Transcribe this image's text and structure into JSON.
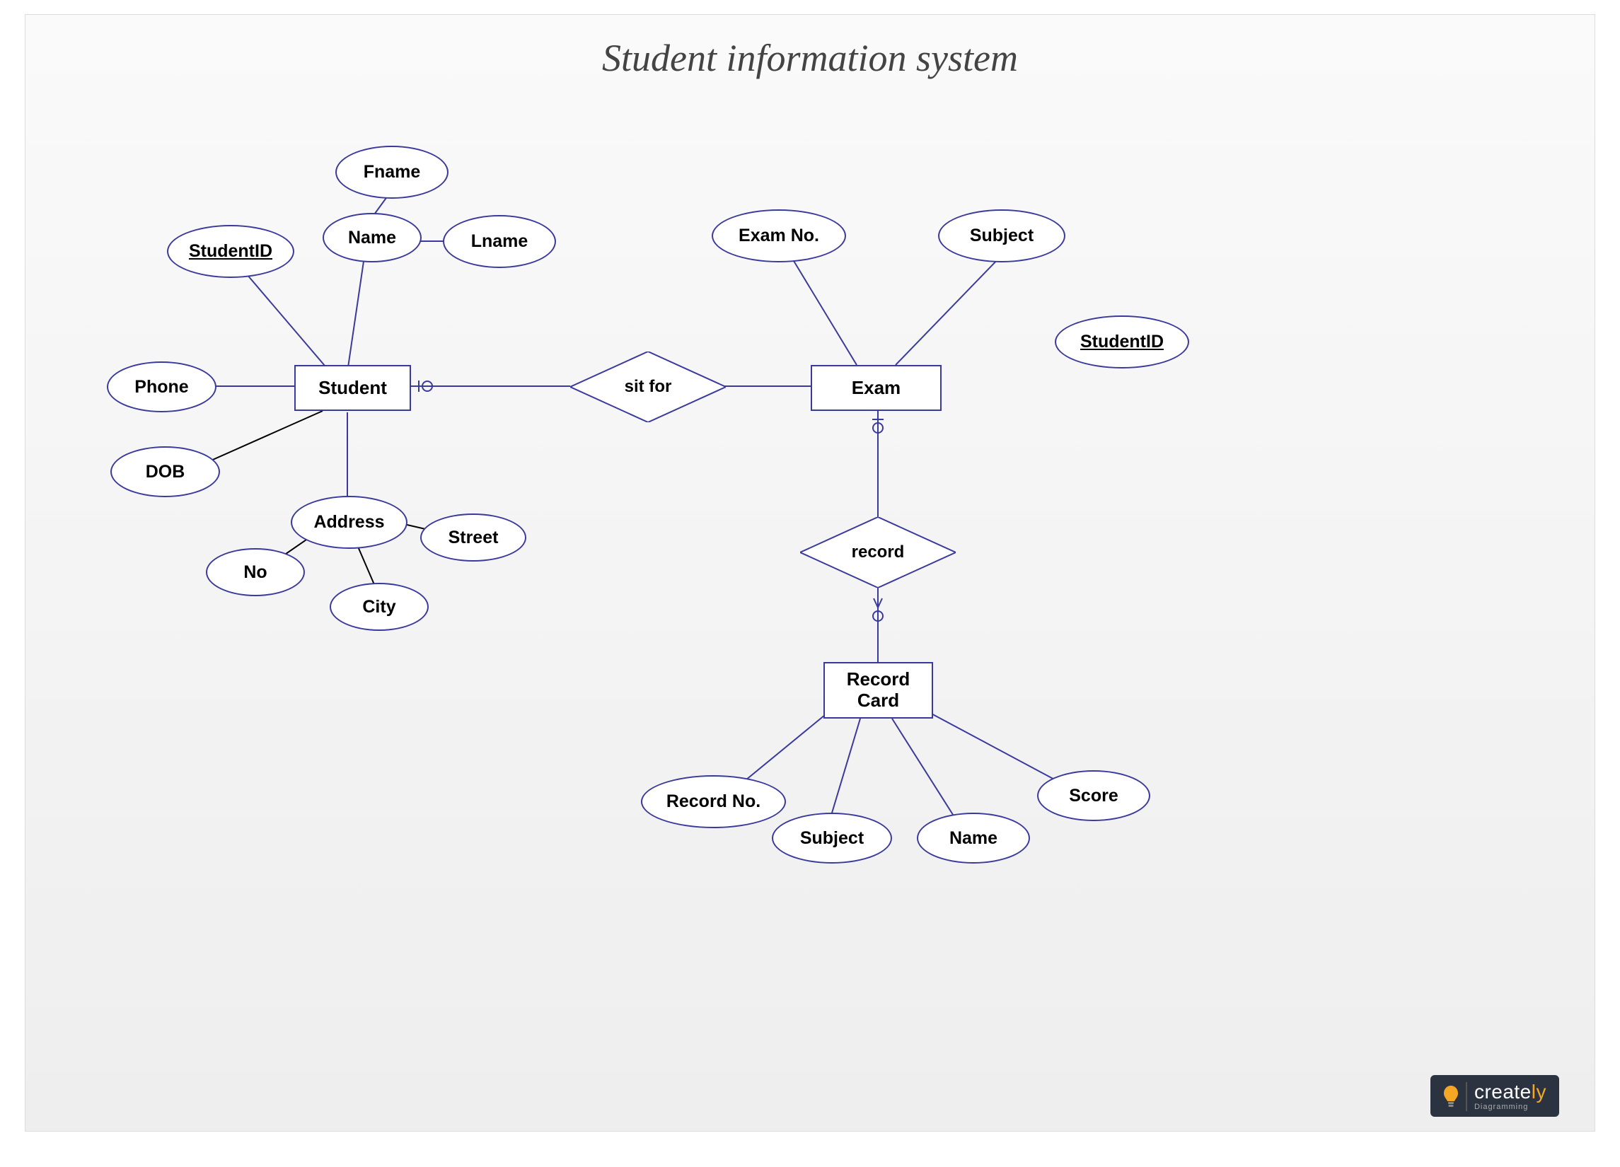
{
  "title": "Student information system",
  "entities": {
    "student": "Student",
    "exam": "Exam",
    "recordCard": "Record\nCard"
  },
  "relationships": {
    "sitFor": "sit for",
    "record": "record"
  },
  "attributes": {
    "student": {
      "studentId": "StudentID",
      "phone": "Phone",
      "dob": "DOB",
      "name": "Name",
      "fname": "Fname",
      "lname": "Lname",
      "address": "Address",
      "addressNo": "No",
      "addressCity": "City",
      "addressStreet": "Street"
    },
    "exam": {
      "examNo": "Exam No.",
      "subject": "Subject",
      "studentId": "StudentID"
    },
    "recordCard": {
      "recordNo": "Record No.",
      "subject": "Subject",
      "name": "Name",
      "score": "Score"
    }
  },
  "logo": {
    "brand_create": "create",
    "brand_ly": "ly",
    "tagline": "Diagramming"
  }
}
